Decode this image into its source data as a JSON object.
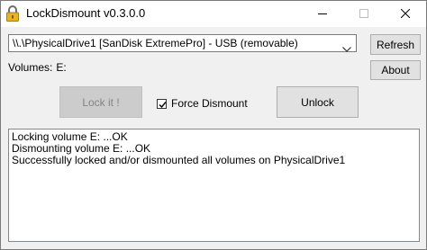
{
  "window": {
    "title": "LockDismount v0.3.0.0",
    "icons": {
      "app": "padlock-icon",
      "minimize": "minimize-icon",
      "maximize": "maximize-icon",
      "close": "close-icon"
    }
  },
  "drive_select": {
    "value": "\\\\.\\PhysicalDrive1  [SanDisk  ExtremePro]  -  USB (removable)",
    "dropdown_icon": "chevron-down-icon"
  },
  "buttons": {
    "refresh": "Refresh",
    "about": "About",
    "lock": "Lock it !",
    "unlock": "Unlock"
  },
  "volumes": {
    "label": "Volumes:",
    "value": "E:"
  },
  "force_dismount": {
    "label": "Force Dismount",
    "checked": true
  },
  "log": {
    "lines": [
      "Locking volume E: ...OK",
      "Dismounting volume E: ...OK",
      "Successfully locked and/or dismounted all volumes on PhysicalDrive1"
    ]
  },
  "colors": {
    "window_bg": "#f0f0f0",
    "titlebar_bg": "#ffffff",
    "button_bg": "#e1e1e1",
    "disabled_button_bg": "#cccccc",
    "icon_gold": "#e8b325"
  }
}
